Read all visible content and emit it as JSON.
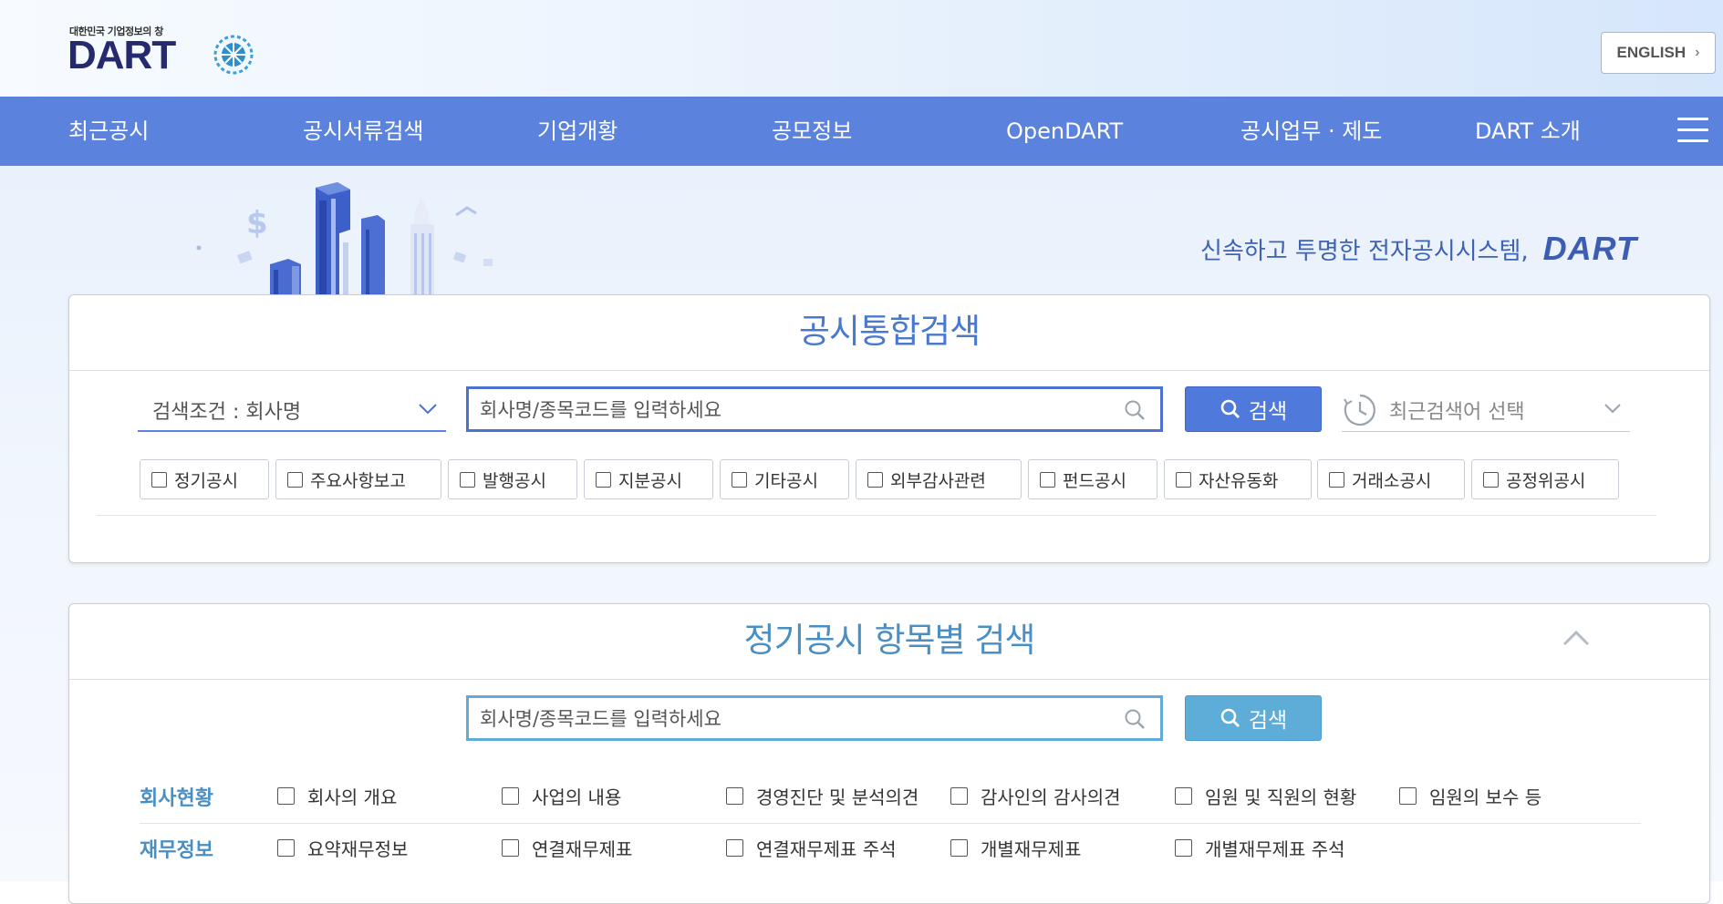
{
  "header": {
    "logo_tagline": "대한민국 기업정보의 창",
    "logo_text": "DART",
    "english_button": "ENGLISH"
  },
  "nav": {
    "items": [
      "최근공시",
      "공시서류검색",
      "기업개황",
      "공모정보",
      "OpenDART",
      "공시업무 · 제도",
      "DART 소개"
    ]
  },
  "hero": {
    "slogan": "신속하고 투명한 전자공시시스템,",
    "slogan_brand": "DART"
  },
  "integrated_search": {
    "title": "공시통합검색",
    "condition_label": "검색조건 : 회사명",
    "input_placeholder": "회사명/종목코드를 입력하세요",
    "search_button": "검색",
    "recent_placeholder": "최근검색어 선택",
    "filters": [
      "정기공시",
      "주요사항보고",
      "발행공시",
      "지분공시",
      "기타공시",
      "외부감사관련",
      "펀드공시",
      "자산유동화",
      "거래소공시",
      "공정위공시"
    ]
  },
  "periodic_search": {
    "title": "정기공시 항목별 검색",
    "input_placeholder": "회사명/종목코드를 입력하세요",
    "search_button": "검색",
    "categories": [
      {
        "label": "회사현황",
        "items": [
          "회사의 개요",
          "사업의 내용",
          "경영진단 및 분석의견",
          "감사인의 감사의견",
          "임원 및 직원의 현황",
          "임원의 보수 등"
        ]
      },
      {
        "label": "재무정보",
        "items": [
          "요약재무정보",
          "연결재무제표",
          "연결재무제표 주석",
          "개별재무제표",
          "개별재무제표 주석"
        ]
      }
    ]
  },
  "colors": {
    "nav_bg": "#5b82dc",
    "primary_button": "#4f7adb",
    "secondary_button": "#5eadd9",
    "title_blue": "#4a78cf"
  }
}
